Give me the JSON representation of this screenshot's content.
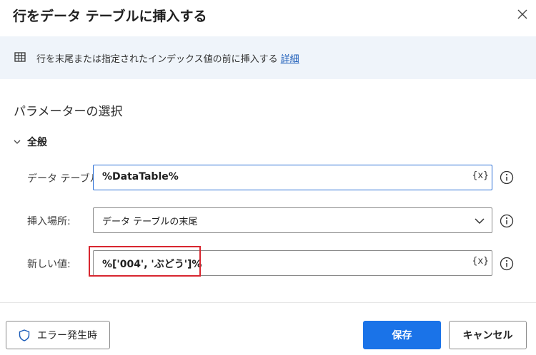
{
  "dialog": {
    "title": "行をデータ テーブルに挿入する",
    "close_icon": "close-icon"
  },
  "info": {
    "icon": "table-icon",
    "text": "行を末尾または指定されたインデックス値の前に挿入する",
    "link": "詳細",
    "link_color": "#1a5bb8"
  },
  "params": {
    "section_title": "パラメーターの選択",
    "group_label": "全般",
    "rows": [
      {
        "label": "データ テーブル:",
        "value": "%DataTable%",
        "var_button": "{x}"
      },
      {
        "label": "挿入場所:",
        "value": "データ テーブルの末尾"
      },
      {
        "label": "新しい値:",
        "value": "%['004', 'ぶどう']%",
        "var_button": "{x}"
      }
    ]
  },
  "footer": {
    "error_button": "エラー発生時",
    "save_button": "保存",
    "cancel_button": "キャンセル"
  },
  "colors": {
    "accent": "#1a73e8",
    "highlight": "#d8262f",
    "info_band": "#eff4fa"
  }
}
